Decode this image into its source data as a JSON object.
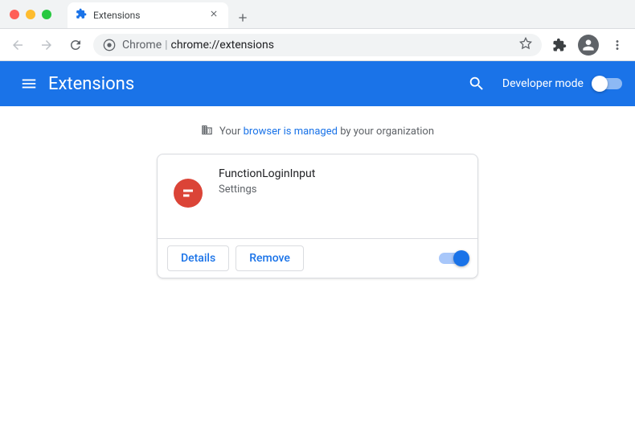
{
  "tab": {
    "title": "Extensions"
  },
  "omnibox": {
    "prefix": "Chrome",
    "separator": "|",
    "path": "chrome://extensions"
  },
  "header": {
    "title": "Extensions",
    "devmode_label": "Developer mode",
    "devmode_on": false
  },
  "notice": {
    "pre": "Your",
    "link": "browser is managed",
    "post": "by your organization"
  },
  "extension": {
    "name": "FunctionLoginInput",
    "description": "Settings",
    "details_label": "Details",
    "remove_label": "Remove",
    "enabled": true
  }
}
